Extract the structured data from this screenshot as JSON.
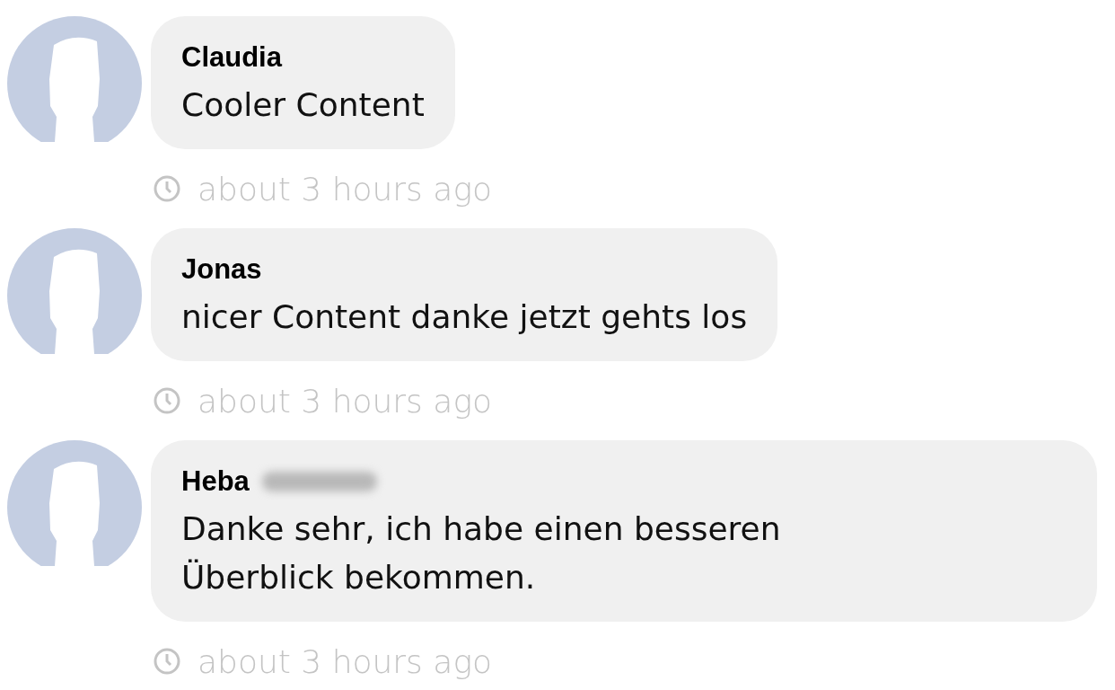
{
  "comments": [
    {
      "author": "Claudia",
      "surname_blurred": false,
      "text": "Cooler Content",
      "time": "about 3 hours ago"
    },
    {
      "author": "Jonas",
      "surname_blurred": false,
      "text": "nicer Content danke jetzt gehts los",
      "time": "about 3 hours ago"
    },
    {
      "author": "Heba",
      "surname_blurred": true,
      "text": "Danke sehr, ich habe einen besseren Überblick bekommen.",
      "time": "about 3 hours ago"
    }
  ]
}
